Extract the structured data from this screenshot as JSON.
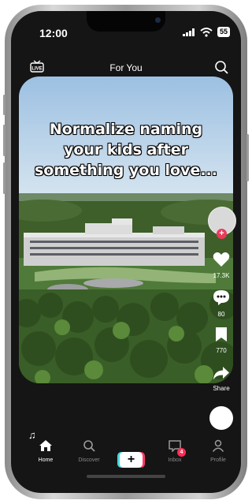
{
  "status_bar": {
    "time": "12:00",
    "battery": "55"
  },
  "top_bar": {
    "title": "For You",
    "live_icon": "live-tv-icon",
    "search_icon": "search-icon"
  },
  "video": {
    "caption": "Normalize naming your kids after something you love..."
  },
  "actions": {
    "likes": "17.3K",
    "comments": "80",
    "saves": "770",
    "share_label": "Share"
  },
  "bottom_nav": {
    "items": [
      {
        "label": "Home",
        "icon": "home-icon",
        "active": true
      },
      {
        "label": "Discover",
        "icon": "search-icon",
        "active": false
      },
      {
        "label": "Inbox",
        "icon": "inbox-icon",
        "active": false,
        "badge": "4"
      },
      {
        "label": "Profile",
        "icon": "profile-icon",
        "active": false
      }
    ],
    "create_label": "+"
  },
  "colors": {
    "background": "#151515",
    "accent_pink": "#ff3b6a",
    "accent_cyan": "#4ad7dd",
    "badge_red": "#ff2d55"
  }
}
